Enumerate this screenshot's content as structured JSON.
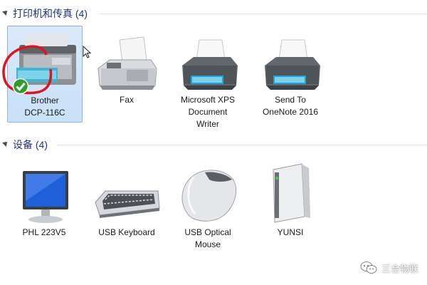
{
  "groups": [
    {
      "title": "打印机和传真 (4)",
      "items": [
        {
          "label": "Brother\nDCP-116C",
          "icon": "multifunction-printer-icon",
          "selected": true,
          "default": true
        },
        {
          "label": "Fax",
          "icon": "fax-machine-icon"
        },
        {
          "label": "Microsoft XPS\nDocument\nWriter",
          "icon": "printer-icon"
        },
        {
          "label": "Send To\nOneNote 2016",
          "icon": "printer-icon"
        }
      ]
    },
    {
      "title": "设备 (4)",
      "items": [
        {
          "label": "PHL 223V5",
          "icon": "monitor-icon"
        },
        {
          "label": "USB Keyboard",
          "icon": "keyboard-icon"
        },
        {
          "label": "USB Optical\nMouse",
          "icon": "mouse-icon"
        },
        {
          "label": "YUNSI",
          "icon": "external-drive-icon"
        }
      ]
    }
  ],
  "watermark": {
    "text": "三合物联"
  },
  "colors": {
    "header_text": "#1e3287",
    "selection": "#c8e0f8",
    "annotation": "#e0141e"
  }
}
